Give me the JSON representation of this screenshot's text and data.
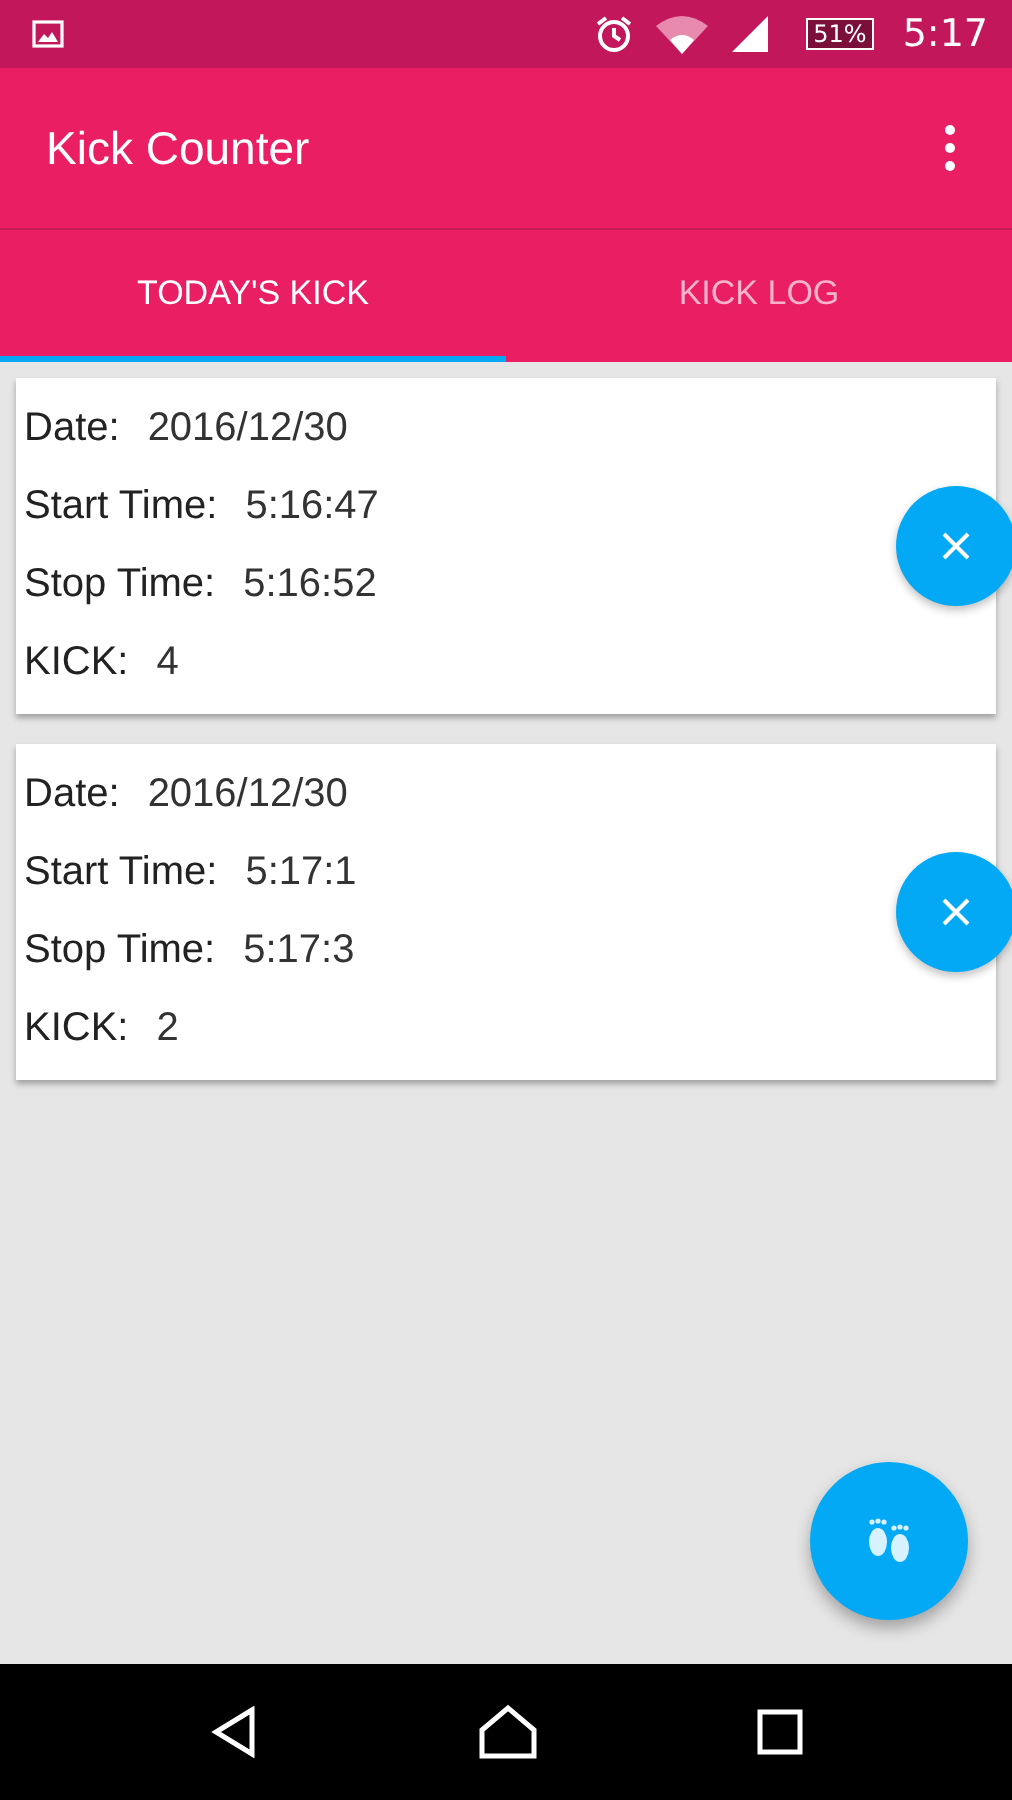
{
  "status_bar": {
    "battery": "51%",
    "time": "5:17"
  },
  "toolbar": {
    "title": "Kick Counter"
  },
  "tabs": [
    {
      "label": "TODAY'S KICK",
      "selected": true
    },
    {
      "label": "KICK LOG",
      "selected": false
    }
  ],
  "records": [
    {
      "fields": [
        {
          "label": "Date:",
          "value": "2016/12/30"
        },
        {
          "label": "Start Time:",
          "value": "5:16:47"
        },
        {
          "label": "Stop Time:",
          "value": "5:16:52"
        },
        {
          "label": "KICK:",
          "value": "4"
        }
      ]
    },
    {
      "fields": [
        {
          "label": "Date:",
          "value": "2016/12/30"
        },
        {
          "label": "Start Time:",
          "value": "5:17:1"
        },
        {
          "label": "Stop Time:",
          "value": "5:17:3"
        },
        {
          "label": "KICK:",
          "value": "2"
        }
      ]
    }
  ]
}
